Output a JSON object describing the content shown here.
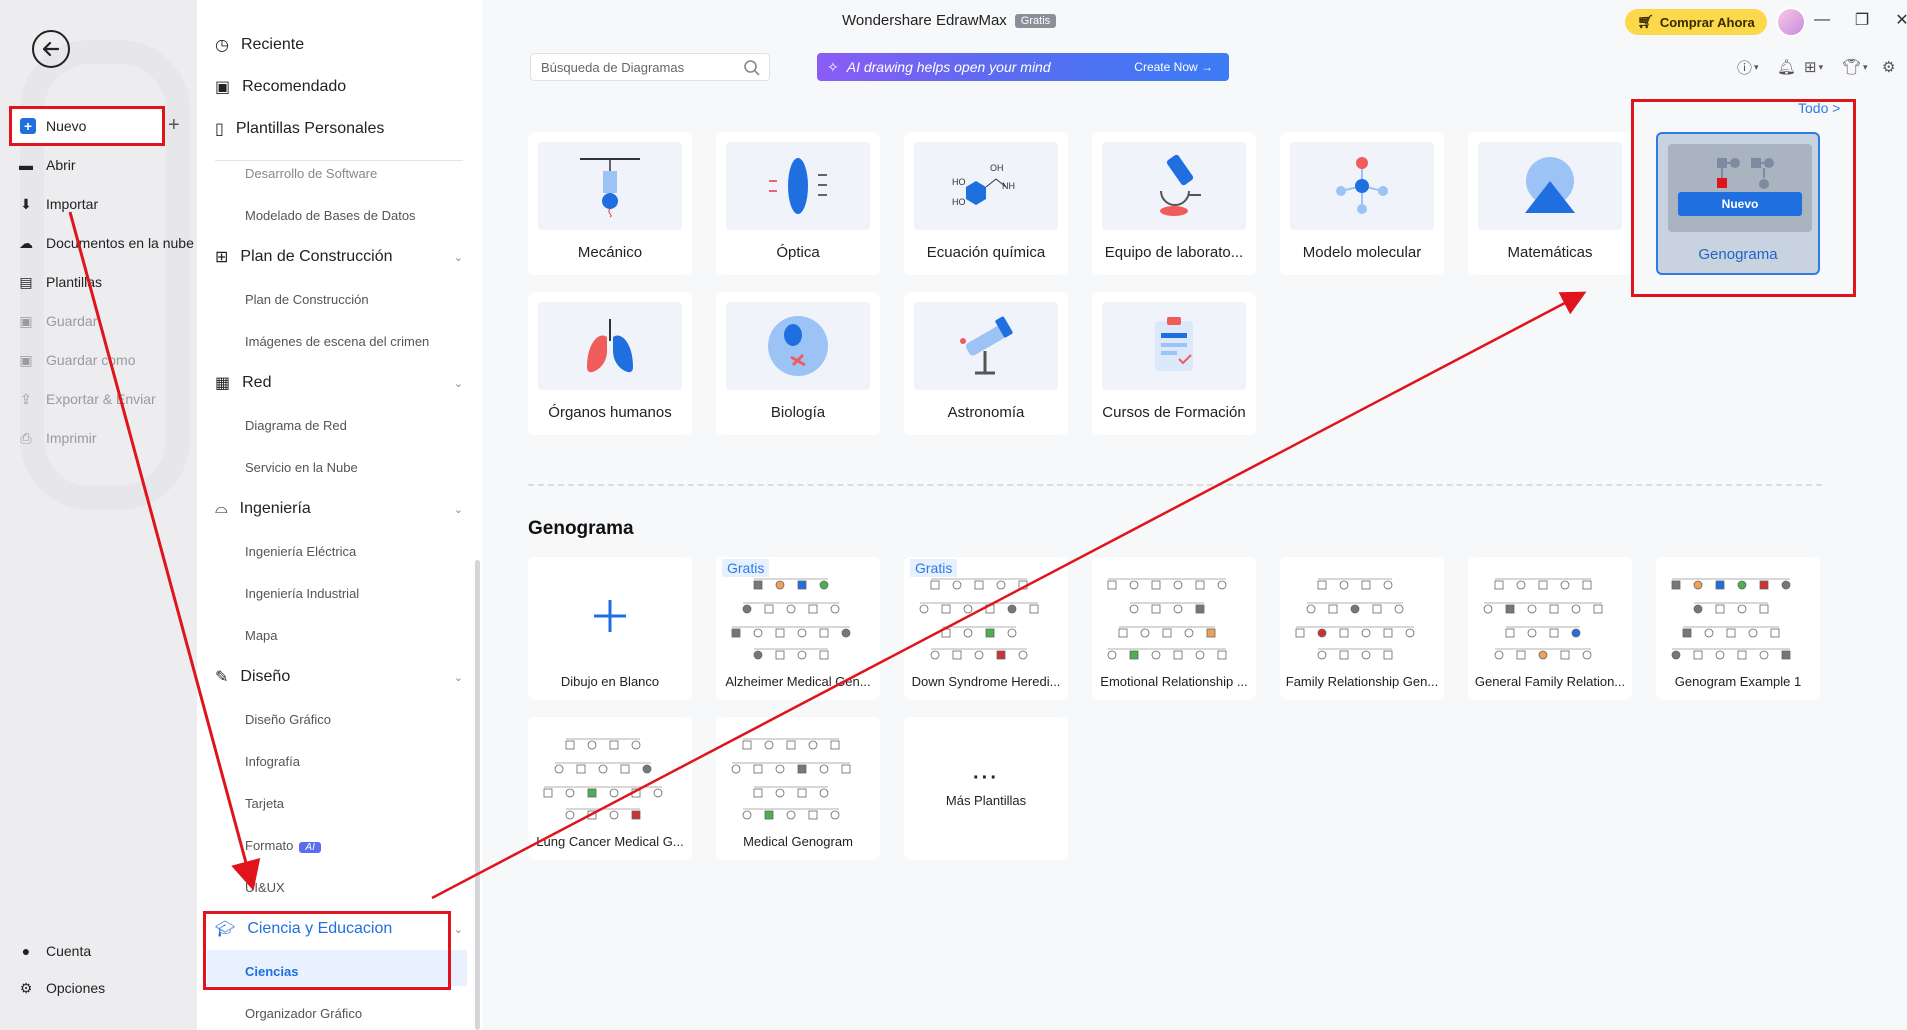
{
  "window": {
    "title": "Wondershare EdrawMax",
    "title_badge": "Gratis",
    "buy_label": "Comprar Ahora"
  },
  "rail": {
    "items": [
      {
        "label": "Nuevo"
      },
      {
        "label": "Abrir"
      },
      {
        "label": "Importar"
      },
      {
        "label": "Documentos en la nube"
      },
      {
        "label": "Plantillas"
      },
      {
        "label": "Guardar"
      },
      {
        "label": "Guardar como"
      },
      {
        "label": "Exportar & Enviar"
      },
      {
        "label": "Imprimir"
      }
    ],
    "bottom": [
      {
        "label": "Cuenta"
      },
      {
        "label": "Opciones"
      }
    ]
  },
  "categories": {
    "top": [
      {
        "label": "Reciente"
      },
      {
        "label": "Recomendado"
      },
      {
        "label": "Plantillas Personales"
      }
    ],
    "cut_item": "Desarrollo de Software",
    "sub1": "Modelado de Bases de Datos",
    "construccion": {
      "label": "Plan de Construcción",
      "subs": [
        "Plan de Construcción",
        "Imágenes de escena del crimen"
      ]
    },
    "red": {
      "label": "Red",
      "subs": [
        "Diagrama de Red",
        "Servicio en la Nube"
      ]
    },
    "ingenieria": {
      "label": "Ingeniería",
      "subs": [
        "Ingeniería Eléctrica",
        "Ingeniería Industrial",
        "Mapa"
      ]
    },
    "diseno": {
      "label": "Diseño",
      "subs": [
        "Diseño Gráfico",
        "Infografía",
        "Tarjeta",
        "Formato",
        "UI&UX"
      ],
      "ai_badge": "AI"
    },
    "ciencia": {
      "label": "Ciencia y Educacion",
      "subs": [
        "Ciencias",
        "Organizador Gráfico"
      ]
    }
  },
  "search": {
    "placeholder": "Búsqueda de Diagramas"
  },
  "ai_banner": {
    "text": "AI drawing helps open your mind",
    "cta": "Create Now"
  },
  "todo_link": "Todo >",
  "science_cards": [
    {
      "label": "Mecánico",
      "icon": "pendulum-icon"
    },
    {
      "label": "Óptica",
      "icon": "lens-icon"
    },
    {
      "label": "Ecuación química",
      "icon": "molecule-formula-icon"
    },
    {
      "label": "Equipo de laborato...",
      "icon": "microscope-icon"
    },
    {
      "label": "Modelo molecular",
      "icon": "molecular-model-icon"
    },
    {
      "label": "Matemáticas",
      "icon": "shapes-icon"
    },
    {
      "label": "Genograma",
      "icon": "genogram-icon",
      "badge": "Nuevo",
      "selected": true
    },
    {
      "label": "Órganos humanos",
      "icon": "lungs-icon"
    },
    {
      "label": "Biología",
      "icon": "cell-icon"
    },
    {
      "label": "Astronomía",
      "icon": "telescope-icon"
    },
    {
      "label": "Cursos de Formación",
      "icon": "clipboard-icon"
    }
  ],
  "section_title": "Genograma",
  "templates": [
    {
      "label": "Dibujo en Blanco",
      "blank": true
    },
    {
      "label": "Alzheimer Medical Gen...",
      "tag": "Gratis"
    },
    {
      "label": "Down Syndrome Heredi...",
      "tag": "Gratis"
    },
    {
      "label": "Emotional Relationship ..."
    },
    {
      "label": "Family Relationship Gen..."
    },
    {
      "label": "General Family Relation..."
    },
    {
      "label": "Genogram Example 1"
    },
    {
      "label": "Lung Cancer Medical G..."
    },
    {
      "label": "Medical Genogram"
    },
    {
      "label": "Más Plantillas",
      "more": true
    }
  ],
  "colors": {
    "accent": "#2f7ae5",
    "annotation_red": "#e0141c",
    "buy_yellow": "#fbd94a"
  }
}
